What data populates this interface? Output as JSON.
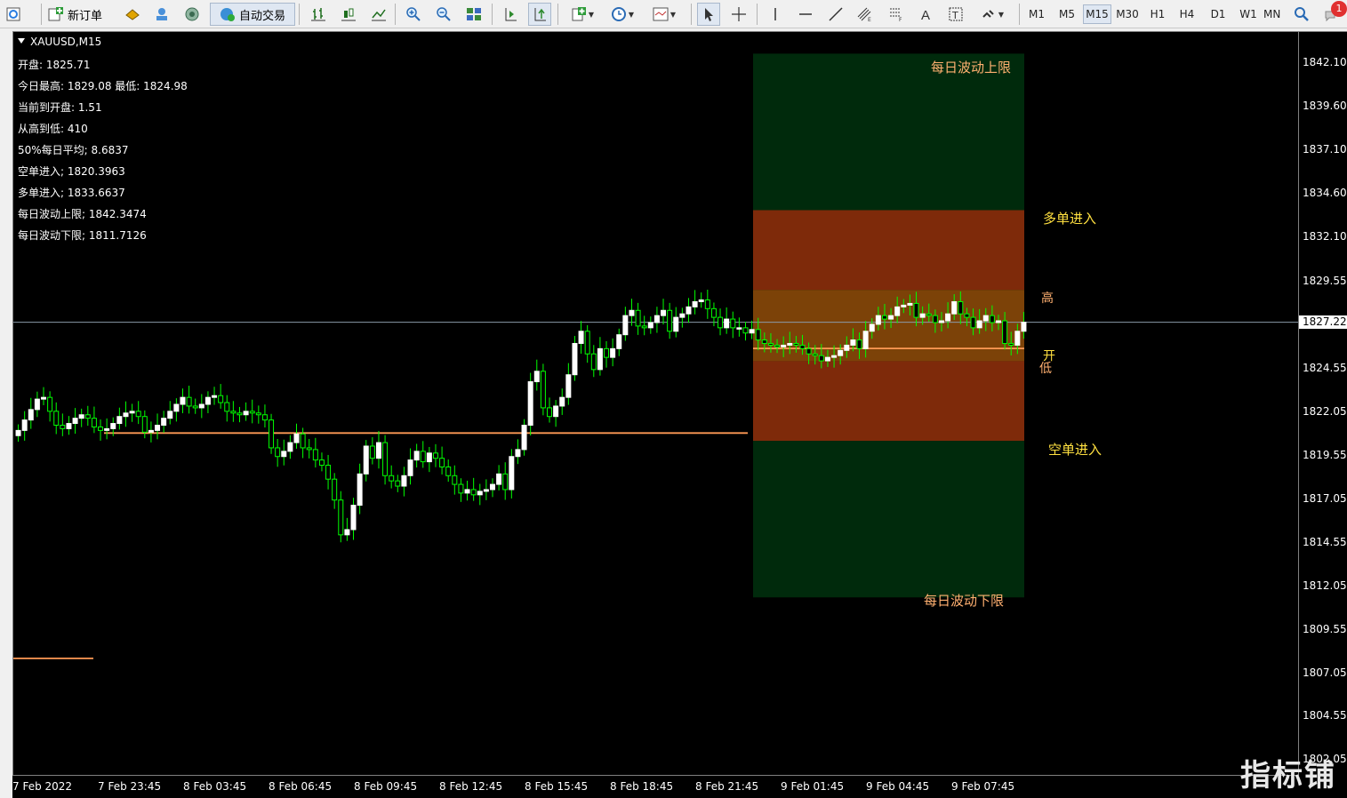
{
  "toolbar": {
    "new_order_label": "新订单",
    "auto_trade_label": "自动交易",
    "timeframes": [
      "M1",
      "M5",
      "M15",
      "M30",
      "H1",
      "H4",
      "D1",
      "W1",
      "MN"
    ],
    "active_timeframe": "M15",
    "notification_count": "1"
  },
  "chart": {
    "symbol": "XAUUSD,M15",
    "info_lines": [
      "开盘: 1825.71",
      "今日最高: 1829.08  最低: 1824.98",
      "当前到开盘: 1.51",
      "从高到低: 410",
      "50%每日平均; 8.6837",
      "空单进入; 1820.3963",
      "多单进入; 1833.6637",
      "每日波动上限; 1842.3474",
      "每日波动下限; 1811.7126"
    ],
    "zone_labels": {
      "upper_limit": "每日波动上限",
      "lower_limit": "每日波动下限",
      "long_entry": "多单进入",
      "short_entry": "空单进入",
      "high": "高",
      "open": "开",
      "low": "低"
    },
    "current_price": "1827.22",
    "price_ticks": [
      "1842.10",
      "1839.60",
      "1837.10",
      "1834.60",
      "1832.10",
      "1829.55",
      "1824.55",
      "1822.05",
      "1819.55",
      "1817.05",
      "1814.55",
      "1812.05",
      "1809.55",
      "1807.05",
      "1804.55",
      "1802.05"
    ],
    "time_ticks": [
      "7 Feb 2022",
      "7 Feb 23:45",
      "8 Feb 03:45",
      "8 Feb 06:45",
      "8 Feb 09:45",
      "8 Feb 12:45",
      "8 Feb 15:45",
      "8 Feb 18:45",
      "8 Feb 21:45",
      "9 Feb 01:45",
      "9 Feb 04:45",
      "9 Feb 07:45"
    ],
    "watermark": "指标铺",
    "colors": {
      "background": "#000000",
      "bull_candle": "#ffffff",
      "wick": "#00ff00",
      "zone_green": "#002a0c",
      "zone_red": "#7e2a0a",
      "zone_orange": "#7c4208",
      "open_line": "#ff9a55",
      "label_orange": "#ffb070",
      "label_yellow": "#ffe040"
    }
  },
  "chart_data": {
    "type": "candlestick",
    "ylim": [
      1801.1,
      1843.9
    ],
    "closes": [
      1821.0,
      1821.6,
      1822.2,
      1822.8,
      1822.9,
      1822.1,
      1821.3,
      1821.1,
      1821.4,
      1821.7,
      1821.9,
      1821.7,
      1821.2,
      1821.0,
      1821.1,
      1821.4,
      1821.8,
      1822.0,
      1822.1,
      1821.8,
      1820.9,
      1821.0,
      1821.3,
      1821.7,
      1822.1,
      1822.5,
      1822.9,
      1822.4,
      1822.3,
      1822.5,
      1822.9,
      1823.0,
      1822.6,
      1822.1,
      1822.0,
      1821.9,
      1822.1,
      1822.0,
      1821.9,
      1821.6,
      1820.0,
      1819.5,
      1819.8,
      1820.3,
      1820.8,
      1820.0,
      1819.9,
      1819.3,
      1819.0,
      1818.2,
      1817.0,
      1815.0,
      1815.3,
      1816.7,
      1818.5,
      1820.1,
      1819.4,
      1820.3,
      1818.4,
      1818.1,
      1817.8,
      1818.4,
      1819.3,
      1819.8,
      1819.2,
      1819.7,
      1819.4,
      1818.9,
      1818.4,
      1817.9,
      1817.4,
      1817.6,
      1817.3,
      1817.5,
      1817.6,
      1817.9,
      1818.5,
      1817.6,
      1819.5,
      1819.9,
      1821.3,
      1823.8,
      1824.4,
      1822.3,
      1821.8,
      1822.4,
      1822.9,
      1824.2,
      1826.0,
      1826.7,
      1825.4,
      1824.5,
      1825.7,
      1825.2,
      1825.7,
      1826.5,
      1827.6,
      1827.9,
      1827.0,
      1826.9,
      1827.2,
      1827.6,
      1827.9,
      1826.7,
      1827.5,
      1827.7,
      1828.1,
      1828.4,
      1828.5,
      1828.0,
      1827.5,
      1826.9,
      1827.4,
      1826.9,
      1826.9,
      1826.6,
      1826.8,
      1826.2,
      1826.0,
      1825.9,
      1825.8,
      1825.9,
      1826.0,
      1825.9,
      1825.7,
      1825.4,
      1825.3,
      1825.0,
      1825.2,
      1825.3,
      1825.6,
      1825.9,
      1826.2,
      1825.7,
      1826.7,
      1827.1,
      1827.6,
      1827.4,
      1827.6,
      1828.1,
      1828.2,
      1828.3,
      1827.5,
      1827.7,
      1827.6,
      1827.2,
      1827.3,
      1827.7,
      1828.4,
      1827.7,
      1827.5,
      1826.9,
      1827.3,
      1827.6,
      1827.2,
      1827.3,
      1826.0,
      1825.9,
      1826.7,
      1827.22
    ],
    "open_line_y1": 1820.85,
    "open_line_y2": 1825.71,
    "bands": {
      "upper_limit": 1842.35,
      "long_entry": 1833.66,
      "high": 1829.08,
      "low": 1824.98,
      "short_entry": 1820.4,
      "lower_limit": 1811.71
    }
  }
}
